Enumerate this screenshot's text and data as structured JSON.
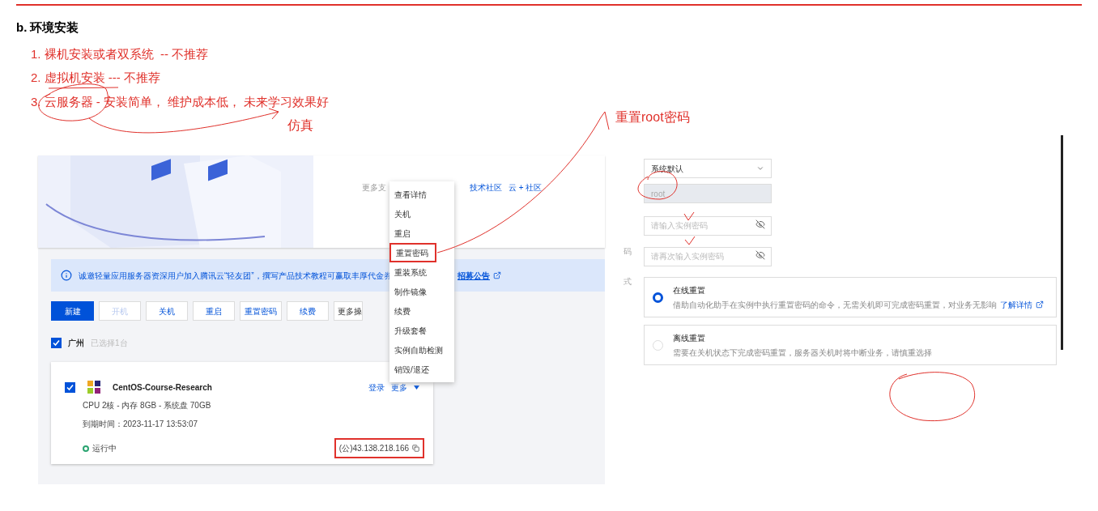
{
  "heading": "b. 环境安装",
  "options": [
    "1. 裸机安装或者双系统  -- 不推荐",
    "2. 虚拟机安装 --- 不推荐",
    "3. 云服务器 - 安装简单， 维护成本低， 未来学习效果好"
  ],
  "note_below": "仿真",
  "note_right": "重置root密码",
  "console": {
    "support_label": "更多支",
    "links": [
      "技术社区",
      "云 + 社区"
    ],
    "notice": "诚邀轻量应用服务器资深用户加入腾讯云“轻友团”，撰写产品技术教程可赢取丰厚代金券",
    "notice_link": "招募公告",
    "toolbar": [
      {
        "label": "新建",
        "kind": "primary"
      },
      {
        "label": "开机",
        "kind": "disabled"
      },
      {
        "label": "关机",
        "kind": "default"
      },
      {
        "label": "重启",
        "kind": "default"
      },
      {
        "label": "重置密码",
        "kind": "default"
      },
      {
        "label": "续费",
        "kind": "default"
      },
      {
        "label": "更多操",
        "kind": "plain"
      }
    ],
    "region": {
      "label": "广州",
      "checked": true,
      "count": "已选择1台"
    },
    "instance": {
      "checked": true,
      "name": "CentOS-Course-Research",
      "actions": [
        "登录",
        "更多"
      ],
      "specs": "CPU 2核 - 内存 8GB - 系统盘 70GB",
      "expiry": "到期时间：2023-11-17 13:53:07",
      "status": "运行中",
      "ip": {
        "text": "(公)43.138.218.166",
        "highlighted": true
      }
    },
    "menu": [
      {
        "label": "查看详情",
        "highlighted": false
      },
      {
        "label": "关机",
        "highlighted": false
      },
      {
        "label": "重启",
        "highlighted": false
      },
      {
        "label": "重置密码",
        "highlighted": true
      },
      {
        "label": "重装系统",
        "highlighted": false
      },
      {
        "label": "制作镜像",
        "highlighted": false
      },
      {
        "label": "续费",
        "highlighted": false
      },
      {
        "label": "升级套餐",
        "highlighted": false
      },
      {
        "label": "实例自助检测",
        "highlighted": false
      },
      {
        "label": "销毁/退还",
        "highlighted": false
      }
    ]
  },
  "reset_form": {
    "side_labels": [
      "码",
      "式"
    ],
    "account_select": "系统默认",
    "username": "root",
    "password_placeholder": "请输入实例密码",
    "confirm_placeholder": "请再次输入实例密码",
    "modes": [
      {
        "title": "在线重置",
        "desc": "借助自动化助手在实例中执行重置密码的命令，无需关机即可完成密码重置，对业务无影响",
        "link": "了解详情",
        "selected": true
      },
      {
        "title": "离线重置",
        "desc": "需要在关机状态下完成密码重置，服务器关机时将中断业务，请慎重选择",
        "selected": false
      }
    ]
  }
}
